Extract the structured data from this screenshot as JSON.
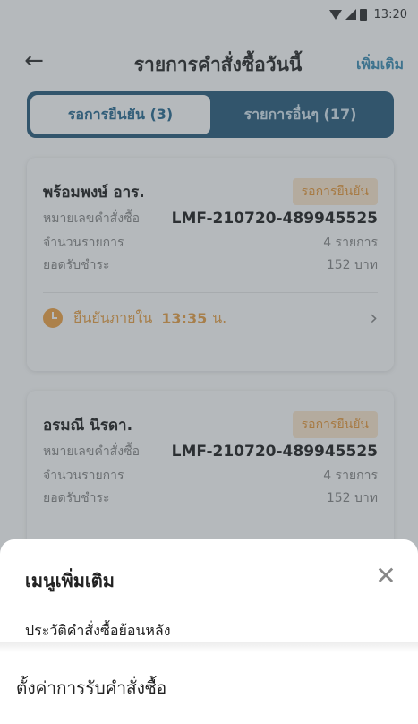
{
  "status_bar": {
    "time": "13:20"
  },
  "header": {
    "back_icon": "arrow-left-icon",
    "title": "รายการคำสั่งซื้อวันนี้",
    "action_label": "เพิ่มเติม"
  },
  "tabs": [
    {
      "label": "รอการยืนยัน (3)",
      "active": true
    },
    {
      "label": "รายการอื่นๆ (17)",
      "active": false
    }
  ],
  "orders": [
    {
      "customer": "พร้อมพงษ์ อาร.",
      "status": "รอการยืนยัน",
      "order_no_label": "หมายเลขคำสั่งซื้อ",
      "order_no": "LMF-210720-489945525",
      "items_label": "จำนวนรายการ",
      "items_value": "4 รายการ",
      "amount_label": "ยอดรับชำระ",
      "amount_value": "152 บาท",
      "confirm_label": "ยืนยันภายใน",
      "confirm_time": "13:35",
      "confirm_unit": "น."
    },
    {
      "customer": "อรมณี นิรดา.",
      "status": "รอการยืนยัน",
      "order_no_label": "หมายเลขคำสั่งซื้อ",
      "order_no": "LMF-210720-489945525",
      "items_label": "จำนวนรายการ",
      "items_value": "4 รายการ",
      "amount_label": "ยอดรับชำระ",
      "amount_value": "152 บาท"
    }
  ],
  "sheet": {
    "title": "เมนูเพิ่มเติม",
    "items": [
      "ประวัติคำสั่งซื้อย้อนหลัง",
      "ตั้งค่าการรับคำสั่งซื้อ"
    ]
  },
  "colors": {
    "accent": "#2d5e7e",
    "link": "#3f8fb5",
    "pending": "#e8a24a"
  }
}
